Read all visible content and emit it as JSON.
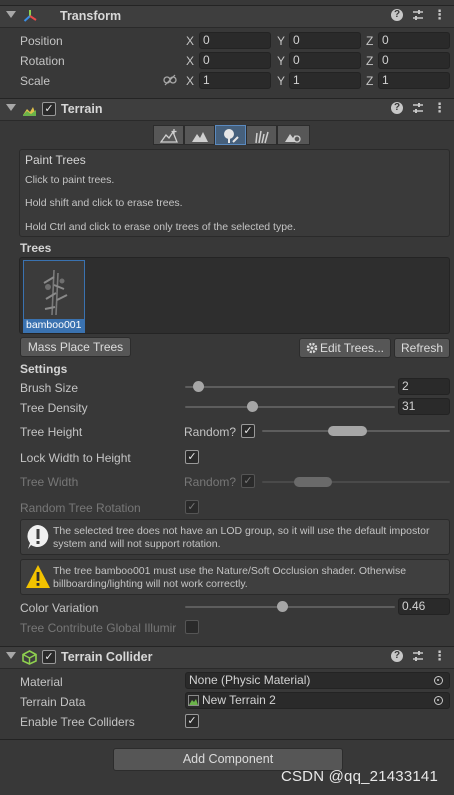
{
  "transform": {
    "title": "Transform",
    "rows": [
      {
        "label": "Position",
        "x": "0",
        "y": "0",
        "z": "0"
      },
      {
        "label": "Rotation",
        "x": "0",
        "y": "0",
        "z": "0"
      },
      {
        "label": "Scale",
        "x": "1",
        "y": "1",
        "z": "1"
      }
    ],
    "axes": {
      "x": "X",
      "y": "Y",
      "z": "Z"
    }
  },
  "terrain": {
    "title": "Terrain",
    "enabled": "✓",
    "tool_title": "Paint Trees",
    "tool_help": [
      "Click to paint trees.",
      "Hold shift and click to erase trees.",
      "Hold Ctrl and click to erase only trees of the selected type."
    ],
    "trees_label": "Trees",
    "tree_item": "bamboo001",
    "mass_place": "Mass Place Trees",
    "edit_trees": "Edit Trees...",
    "refresh": "Refresh",
    "settings_label": "Settings",
    "brush_size": {
      "label": "Brush Size",
      "value": "2",
      "fraction": 0.04
    },
    "tree_density": {
      "label": "Tree Density",
      "value": "31",
      "fraction": 0.31
    },
    "tree_height": {
      "label": "Tree Height",
      "random": "Random?",
      "check": "✓"
    },
    "lock_width": {
      "label": "Lock Width to Height",
      "check": "✓"
    },
    "tree_width": {
      "label": "Tree Width",
      "random": "Random?",
      "check": "✓"
    },
    "random_rotation": {
      "label": "Random Tree Rotation",
      "check": "✓"
    },
    "lod_warning": "The selected tree does not have an LOD group, so it will use the default impostor system and will not support rotation.",
    "shader_warning": "The tree bamboo001 must use the Nature/Soft Occlusion shader. Otherwise billboarding/lighting will not work correctly.",
    "color_variation": {
      "label": "Color Variation",
      "value": "0.46",
      "fraction": 0.46
    },
    "global_illum": {
      "label": "Tree Contribute Global Illumir"
    }
  },
  "collider": {
    "title": "Terrain Collider",
    "enabled": "✓",
    "material_label": "Material",
    "material_value": "None (Physic Material)",
    "data_label": "Terrain Data",
    "data_value": "New Terrain 2",
    "enable_label": "Enable Tree Colliders",
    "enable_check": "✓"
  },
  "add_component": "Add Component",
  "watermark": "CSDN @qq_21433141",
  "colors": {
    "accent": "#46607c",
    "selection": "#3a72b0",
    "warning": "#f2c200"
  }
}
